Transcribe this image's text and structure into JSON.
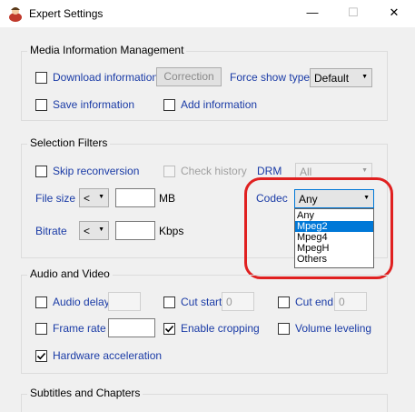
{
  "window": {
    "title": "Expert Settings",
    "minimize_glyph": "—",
    "maximize_glyph": "☐",
    "close_glyph": "✕"
  },
  "media": {
    "legend": "Media Information Management",
    "download_label": "Download information",
    "correction_label": "Correction",
    "force_show_type_label": "Force show type",
    "force_show_type_value": "Default",
    "save_label": "Save information",
    "add_label": "Add information"
  },
  "selection": {
    "legend": "Selection Filters",
    "skip_label": "Skip reconversion",
    "check_history_label": "Check history",
    "drm_label": "DRM",
    "drm_value": "All",
    "file_size_label": "File size",
    "file_size_op": "<",
    "file_size_unit": "MB",
    "codec_label": "Codec",
    "codec_value": "Any",
    "codec_options": [
      "Any",
      "Mpeg2",
      "Mpeg4",
      "MpegH",
      "Others"
    ],
    "codec_highlighted": "Mpeg2",
    "bitrate_label": "Bitrate",
    "bitrate_op": "<",
    "bitrate_unit": "Kbps"
  },
  "av": {
    "legend": "Audio and Video",
    "audio_delay_label": "Audio delay",
    "cut_start_label": "Cut start",
    "cut_start_value": "0",
    "cut_end_label": "Cut end",
    "cut_end_value": "0",
    "frame_rate_label": "Frame rate",
    "enable_cropping_label": "Enable cropping",
    "enable_cropping_checked": true,
    "volume_leveling_label": "Volume leveling",
    "hw_accel_label": "Hardware acceleration",
    "hw_accel_checked": true
  },
  "subs": {
    "legend": "Subtitles and Chapters"
  },
  "colors": {
    "label_blue": "#1a3ba6",
    "highlight_red": "#e02020",
    "selection_blue": "#0078d7"
  }
}
